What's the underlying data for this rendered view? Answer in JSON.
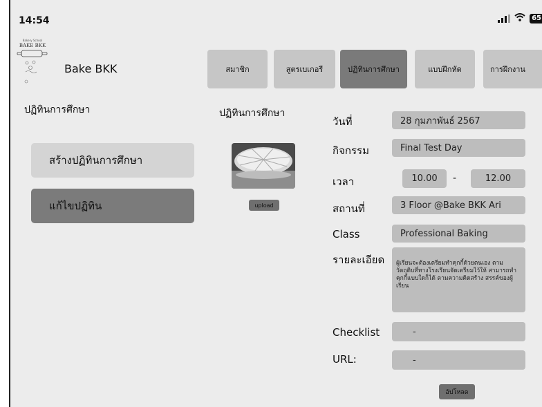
{
  "status_bar": {
    "time": "14:54",
    "battery": "65",
    "icons": [
      "signal-icon",
      "wifi-icon",
      "battery-icon"
    ]
  },
  "brand": {
    "name": "Bake BKK",
    "logo_top_text": "Bakery School",
    "logo_text": "BAKE BKK"
  },
  "nav": {
    "tabs": [
      {
        "label": "สมาชิก",
        "active": false
      },
      {
        "label": "สูตรเบเกอรี",
        "active": false
      },
      {
        "label": "ปฏิทินการศึกษา",
        "active": true
      },
      {
        "label": "แบบฝึกหัด",
        "active": false
      },
      {
        "label": "การฝึกงาน",
        "active": false
      }
    ]
  },
  "sidebar": {
    "title": "ปฏิทินการศึกษา",
    "create_label": "สร้างปฏิทินการศึกษา",
    "edit_label": "แก้ไขปฏิทิน"
  },
  "activity": {
    "title": "ปฏิทินการศึกษา",
    "upload_label": "upload",
    "image_icon": "cake-photo"
  },
  "form": {
    "date_label": "วันที่",
    "date_value": "28 กุมภาพันธ์ 2567",
    "activity_label": "กิจกรรม",
    "activity_value": "Final Test Day",
    "time_label": "เวลา",
    "time_start": "10.00",
    "time_separator": "-",
    "time_end": "12.00",
    "place_label": "สถานที่",
    "place_value": "3 Floor @Bake BKK Ari",
    "class_label": "Class",
    "class_value": "Professional Baking",
    "detail_label": "รายละเอียด",
    "detail_value": "ผู้เรียนจะต้องเตรียมทำคุกกี้ด้วยตนเอง ตามวัตถุดิบที่ทางโรงเรียนจัดเตรียมไว้ให้ สามารถทำคุกกี้แบบใดก็ได้ ตามความคิดสร้าง สรรค์ของผู้เรียน",
    "checklist_label": "Checklist",
    "checklist_value": "-",
    "url_label": "URL:",
    "url_value": "-",
    "submit_label": "อัปโหลด"
  },
  "colors": {
    "background": "#ececec",
    "tab": "#c6c6c6",
    "tab_active": "#7a7a7a",
    "field": "#bdbdbd",
    "button_light": "#d4d4d4",
    "button_dark": "#7b7b7b"
  }
}
